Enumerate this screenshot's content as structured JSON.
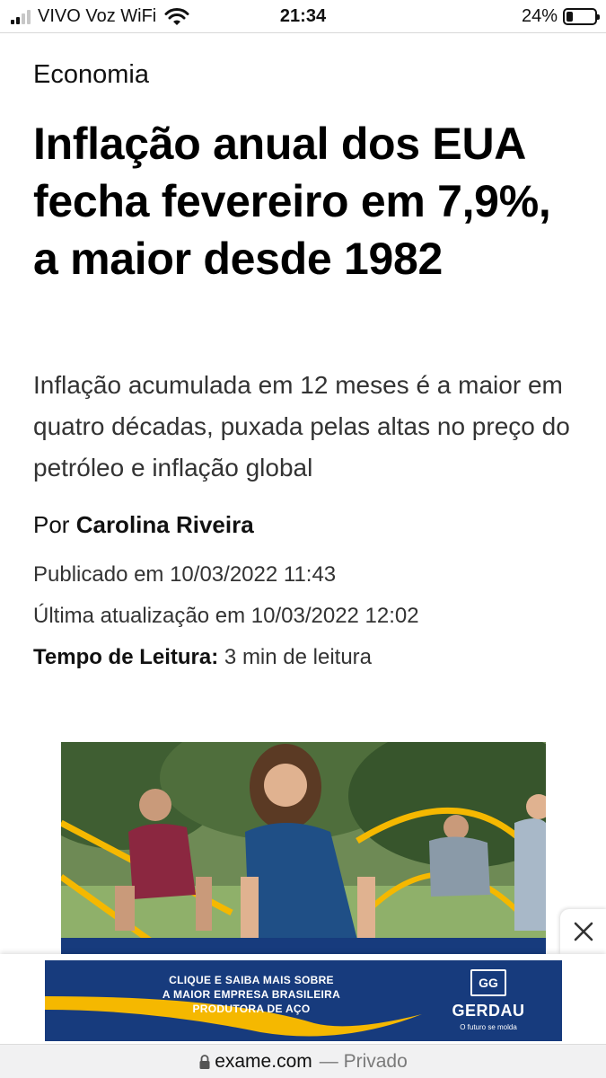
{
  "status_bar": {
    "carrier": "VIVO Voz WiFi",
    "time": "21:34",
    "battery": "24%",
    "signal_bars_filled": 2,
    "signal_bars_total": 4,
    "battery_level": 0.24
  },
  "article": {
    "category": "Economia",
    "headline": "Inflação anual dos EUA fecha fevereiro em 7,9%, a maior desde 1982",
    "subtitle": "Inflação acumulada em 12 meses é a maior em quatro décadas, puxada pelas altas no preço do petróleo e inflação global",
    "byline_prefix": "Por",
    "author": "Carolina Riveira",
    "published": "Publicado em 10/03/2022 11:43",
    "updated": "Última atualização em 10/03/2022 12:02",
    "reading_label": "Tempo de Leitura:",
    "reading_time": "3 min de leitura"
  },
  "ad": {
    "lines": [
      "CLIQUE E SAIBA MAIS SOBRE",
      "A MAIOR EMPRESA BRASILEIRA",
      "PRODUTORA DE AÇO"
    ],
    "logo_mark": "GG",
    "brand": "GERDAU",
    "tagline": "O futuro se molda",
    "banner_color": "#173b7d",
    "accent_color": "#f5b800"
  },
  "url_bar": {
    "domain": "exame.com",
    "mode": "— Privado"
  },
  "icons": {
    "wifi": "wifi-icon",
    "battery": "battery-icon",
    "close": "close-icon",
    "lock": "lock-icon"
  }
}
